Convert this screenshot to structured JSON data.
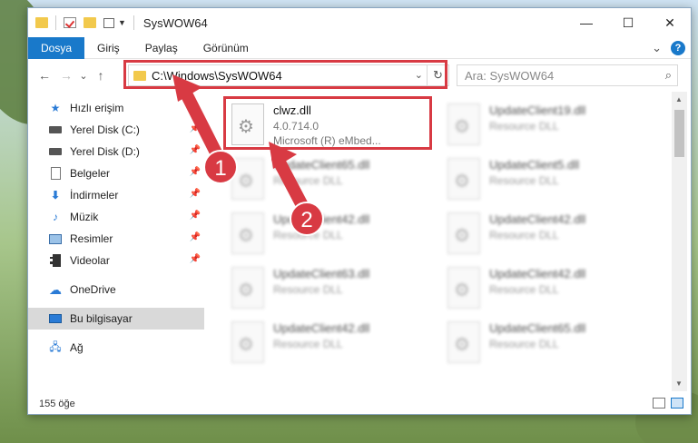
{
  "window": {
    "title": "SysWOW64"
  },
  "ribbon": {
    "tabs": [
      "Dosya",
      "Giriş",
      "Paylaş",
      "Görünüm"
    ],
    "help": "?",
    "collapse": "⌄"
  },
  "nav": {
    "back": "←",
    "forward": "→",
    "dropdown": "⌄",
    "up": "↑"
  },
  "address": {
    "path": "C:\\Windows\\SysWOW64",
    "dropdown": "⌄",
    "refresh": "↻"
  },
  "search": {
    "placeholder": "Ara: SysWOW64",
    "icon": "search-icon"
  },
  "sidebar": {
    "items": [
      {
        "label": "Hızlı erişim",
        "icon": "star-icon"
      },
      {
        "label": "Yerel Disk (C:)",
        "icon": "drive-icon",
        "pinned": true
      },
      {
        "label": "Yerel Disk (D:)",
        "icon": "drive-icon",
        "pinned": true
      },
      {
        "label": "Belgeler",
        "icon": "document-icon",
        "pinned": true
      },
      {
        "label": "İndirmeler",
        "icon": "download-icon",
        "pinned": true
      },
      {
        "label": "Müzik",
        "icon": "music-icon",
        "pinned": true
      },
      {
        "label": "Resimler",
        "icon": "picture-icon",
        "pinned": true
      },
      {
        "label": "Videolar",
        "icon": "video-icon",
        "pinned": true
      },
      {
        "label": "OneDrive",
        "icon": "cloud-icon"
      },
      {
        "label": "Bu bilgisayar",
        "icon": "computer-icon",
        "selected": true
      },
      {
        "label": "Ağ",
        "icon": "network-icon"
      }
    ]
  },
  "files": {
    "left": [
      {
        "name": "clwz.dll",
        "line2": "4.0.714.0",
        "line3": "Microsoft (R) eMbed..."
      },
      {
        "name": "UpdateClient65.dll",
        "line2": "Resource DLL"
      },
      {
        "name": "UpdateClient42.dll",
        "line2": "Resource DLL"
      },
      {
        "name": "UpdateClient63.dll",
        "line2": "Resource DLL"
      },
      {
        "name": "UpdateClient42.dll",
        "line2": "Resource DLL"
      }
    ],
    "right": [
      {
        "name": "UpdateClient19.dll",
        "line2": "Resource DLL"
      },
      {
        "name": "UpdateClient5.dll",
        "line2": "Resource DLL"
      },
      {
        "name": "UpdateClient42.dll",
        "line2": "Resource DLL"
      },
      {
        "name": "UpdateClient42.dll",
        "line2": "Resource DLL"
      },
      {
        "name": "UpdateClient65.dll",
        "line2": "Resource DLL"
      }
    ]
  },
  "status": {
    "count": "155 öğe"
  },
  "annotations": {
    "step1": "1",
    "step2": "2",
    "color": "#d83a43"
  },
  "colors": {
    "accent": "#1979ca",
    "highlight": "#d83a43"
  }
}
